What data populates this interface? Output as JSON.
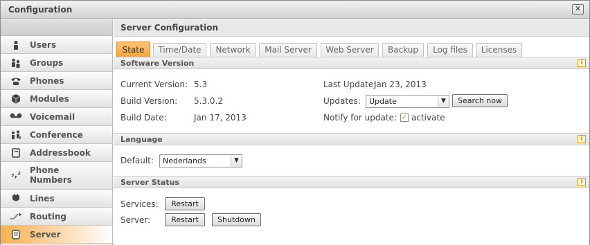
{
  "window": {
    "title": "Configuration",
    "close_icon": "close-icon"
  },
  "sidebar": {
    "items": [
      {
        "label": "Users",
        "icon": "user-icon"
      },
      {
        "label": "Groups",
        "icon": "group-icon"
      },
      {
        "label": "Phones",
        "icon": "phone-icon"
      },
      {
        "label": "Modules",
        "icon": "module-icon"
      },
      {
        "label": "Voicemail",
        "icon": "voicemail-icon"
      },
      {
        "label": "Conference",
        "icon": "conference-icon"
      },
      {
        "label": "Addressbook",
        "icon": "addressbook-icon"
      },
      {
        "label": "Phone Numbers",
        "icon": "phone-numbers-icon"
      },
      {
        "label": "Lines",
        "icon": "lines-icon"
      },
      {
        "label": "Routing",
        "icon": "routing-icon"
      },
      {
        "label": "Server",
        "icon": "server-icon",
        "active": true
      }
    ]
  },
  "main": {
    "title": "Server Configuration",
    "tabs": [
      {
        "label": "State",
        "active": true
      },
      {
        "label": "Time/Date"
      },
      {
        "label": "Network"
      },
      {
        "label": "Mail Server"
      },
      {
        "label": "Web Server"
      },
      {
        "label": "Backup"
      },
      {
        "label": "Log files"
      },
      {
        "label": "Licenses"
      }
    ]
  },
  "software_version": {
    "title": "Software Version",
    "current_version_label": "Current Version:",
    "current_version": "5.3",
    "build_version_label": "Build Version:",
    "build_version": "5.3.0.2",
    "build_date_label": "Build Date:",
    "build_date": "Jan 17, 2013",
    "last_update_label": "Last Update:",
    "last_update": "Jan 23, 2013",
    "updates_label": "Updates:",
    "updates_value": "Update",
    "search_now_label": "Search now",
    "notify_label": "Notify for update:",
    "activate_label": "activate",
    "activate_checked": true
  },
  "language": {
    "title": "Language",
    "default_label": "Default:",
    "default_value": "Nederlands"
  },
  "server_status": {
    "title": "Server Status",
    "services_label": "Services:",
    "server_label": "Server:",
    "restart_label": "Restart",
    "shutdown_label": "Shutdown"
  },
  "colors": {
    "accent": "#f6a43c",
    "info": "#c98a10"
  }
}
